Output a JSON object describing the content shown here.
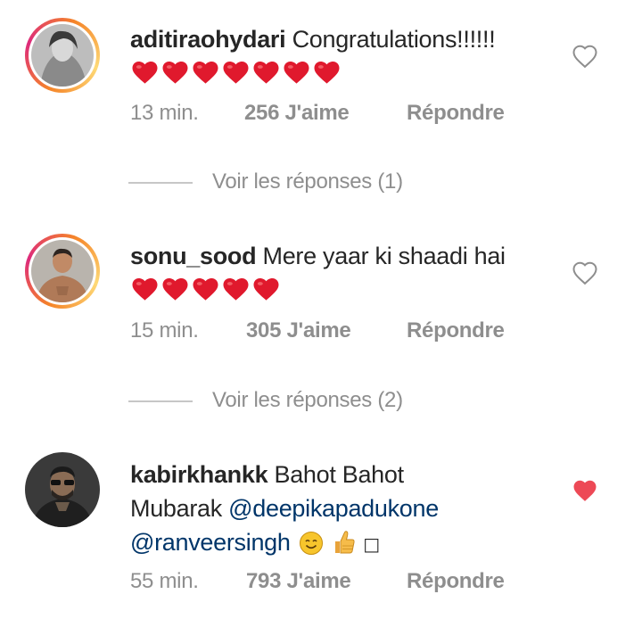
{
  "comments": [
    {
      "username": "aditiraohydari",
      "text": "Congratulations!!!!!!",
      "time": "13 min.",
      "likes": "256 J'aime",
      "reply": "Répondre",
      "view_replies": "Voir les réponses (1)",
      "liked": false,
      "heart_emoji_count": 7
    },
    {
      "username": "sonu_sood",
      "text": "Mere yaar ki shaadi hai",
      "time": "15 min.",
      "likes": "305 J'aime",
      "reply": "Répondre",
      "view_replies": "Voir les réponses (2)",
      "liked": false,
      "heart_emoji_count": 5
    },
    {
      "username": "kabirkhankk",
      "text_1": "Bahot Bahot",
      "text_2": "Mubarak",
      "mention_1": "@deepikapadukone",
      "mention_2": "@ranveersingh",
      "trailing_glyph": "□",
      "time": "55 min.",
      "likes": "793 J'aime",
      "reply": "Répondre",
      "liked": true
    }
  ],
  "colors": {
    "heart_emoji": "#e0192d",
    "liked_heart": "#ed4956",
    "meta_text": "#8e8e8e",
    "mention": "#003569"
  },
  "icons": {
    "like": "heart-outline-icon",
    "liked": "heart-filled-icon",
    "emoji_1": "smiling-face-emoji",
    "emoji_2": "thumbs-up-emoji"
  }
}
